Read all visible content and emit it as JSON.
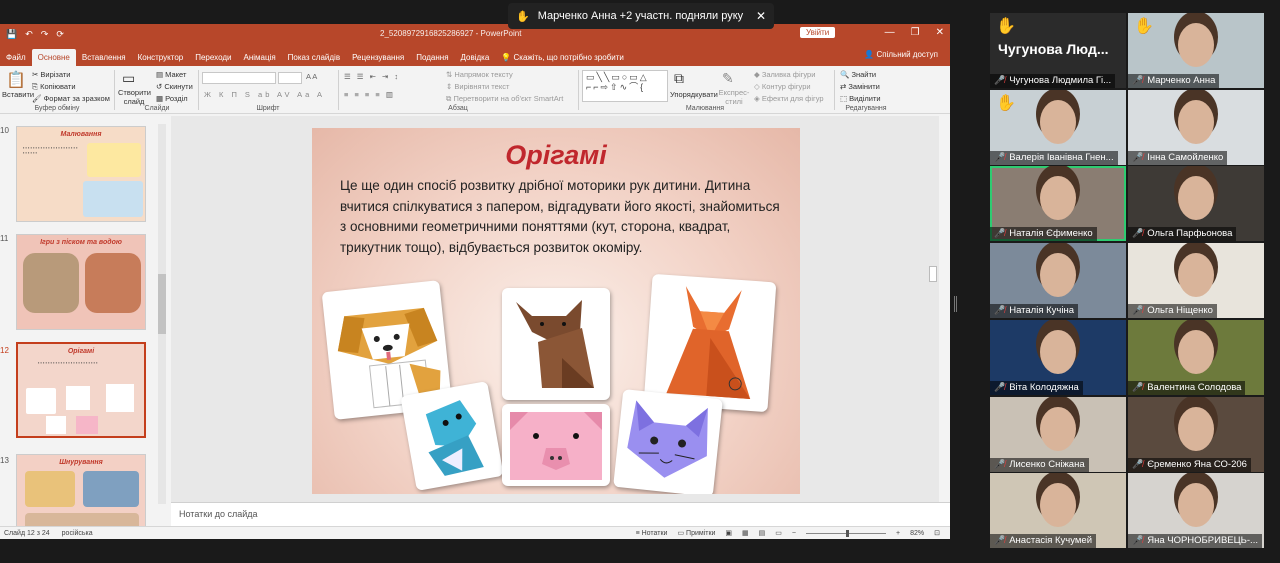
{
  "ppt": {
    "quick_access": [
      "💾",
      "↶",
      "↷",
      "⟳"
    ],
    "doc_title": "2_5208972916825286927  -  PowerPoint",
    "signin_button": "Увійти",
    "window_controls": [
      "—",
      "❐",
      "✕"
    ],
    "tabs": [
      "Файл",
      "Основне",
      "Вставлення",
      "Конструктор",
      "Переходи",
      "Анімація",
      "Показ слайдів",
      "Рецензування",
      "Подання",
      "Довідка"
    ],
    "tell_me": "Скажіть, що потрібно зробити",
    "share": "Спільний доступ",
    "ribbon": {
      "paste": "Вставити",
      "cut": "Вирізати",
      "copy": "Копіювати",
      "format_painter": "Формат за зразком",
      "clipboard_group": "Буфер обміну",
      "new_slide": "Створити слайд",
      "layout": "Макет",
      "reset": "Скинути",
      "section": "Розділ",
      "slides_group": "Слайди",
      "font_group": "Шрифт",
      "text_direction": "Напрямок тексту",
      "align_text": "Вирівняти текст",
      "convert_smartart": "Перетворити на об'єкт SmartArt",
      "paragraph_group": "Абзац",
      "arrange": "Упорядкувати",
      "quick_styles": "Експрес-стилі",
      "shape_fill": "Заливка фігури",
      "shape_outline": "Контур фігури",
      "shape_effects": "Ефекти для фігур",
      "drawing_group": "Малювання",
      "find": "Знайти",
      "replace": "Замінити",
      "select": "Виділити",
      "editing_group": "Редагування"
    },
    "thumbnails": [
      {
        "num": "10",
        "title": "Малювання"
      },
      {
        "num": "11",
        "title": "Ігри з піском та водою"
      },
      {
        "num": "12",
        "title": "Орігамі"
      },
      {
        "num": "13",
        "title": "Шнурування"
      }
    ],
    "slide": {
      "title": "Орігамі",
      "body": "Це ще один спосіб розвитку дрібної моторики рук дитини. Дитина вчитися спілкуватися з папером, відгадувати його якості, знайомиться з основними геометричними поняттями (кут, сторона, квадрат, трикутник тощо), відбувається розвиток окоміру."
    },
    "notes_placeholder": "Нотатки до слайда",
    "status": {
      "slide_of": "Слайд 12 з 24",
      "language": "російська",
      "notes": "Нотатки",
      "comments": "Примітки",
      "zoom": "82%"
    }
  },
  "toast": {
    "icon": "✋",
    "text": "Марченко Анна +2 участн. подняли руку",
    "close": "✕"
  },
  "participants": [
    {
      "name": "Чугунова Людмила Гі...",
      "hand": true,
      "big_name": "Чугунова Люд...",
      "bg": "#2b2b2b"
    },
    {
      "name": "Марченко Анна",
      "hand": true,
      "bg": "#b9c5c9"
    },
    {
      "name": "Валерія Іванівна Гнен...",
      "hand": true,
      "bg": "#c8d0d4"
    },
    {
      "name": "Інна Самойленко",
      "hand": false,
      "bg": "#d9dde0"
    },
    {
      "name": "Наталія Єфименко",
      "hand": false,
      "bg": "#8a7d72",
      "active": true
    },
    {
      "name": "Ольга Парфьонова",
      "hand": false,
      "bg": "#3e3a36"
    },
    {
      "name": "Наталія Кучіна",
      "hand": false,
      "bg": "#7c8a9a"
    },
    {
      "name": "Ольга Ніщенко",
      "hand": false,
      "bg": "#e8e4dc"
    },
    {
      "name": "Віта Колодяжна",
      "hand": false,
      "bg": "#1d3a66"
    },
    {
      "name": "Валентина Солодова",
      "hand": false,
      "bg": "#6d7a3c"
    },
    {
      "name": "Лисенко Сніжана",
      "hand": false,
      "bg": "#c9c1b5"
    },
    {
      "name": "Єременко Яна СО-206",
      "hand": false,
      "bg": "#5a4a3e"
    },
    {
      "name": "Анастасія Кучумей",
      "hand": false,
      "bg": "#cfc6b5"
    },
    {
      "name": "Яна ЧОРНОБРИВЕЦЬ-...",
      "hand": false,
      "bg": "#d6d3cf"
    }
  ]
}
